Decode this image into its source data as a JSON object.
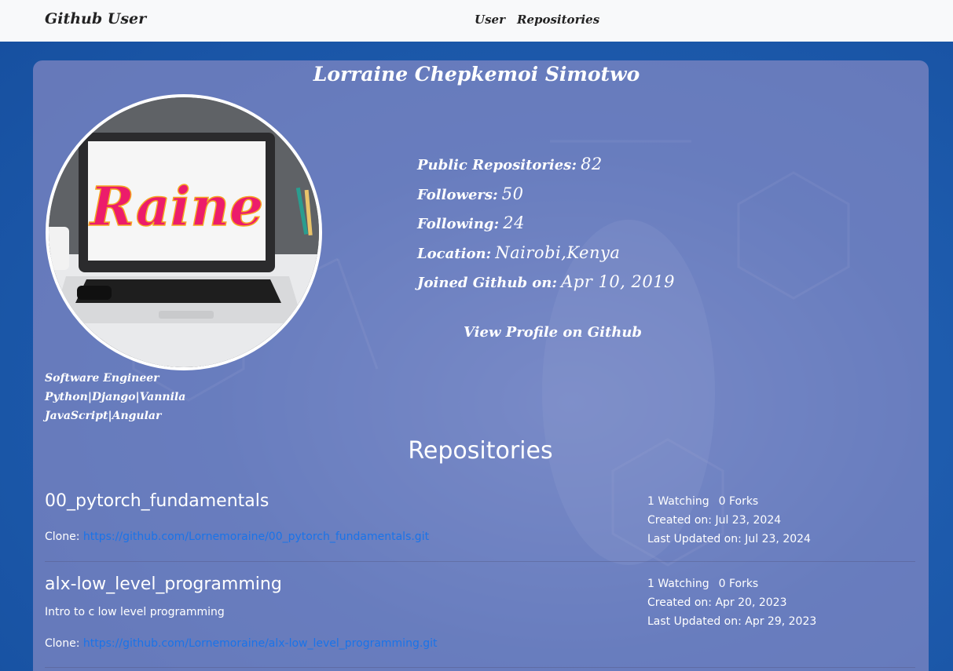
{
  "navbar": {
    "brand": "Github User",
    "links": [
      "User",
      "Repositories"
    ]
  },
  "profile": {
    "name": "Lorraine Chepkemoi Simotwo",
    "avatar_text": "Raine",
    "bio": "Software Engineer Python|Django|Vannila JavaScript|Angular",
    "stats": [
      {
        "label": "Public Repositories:",
        "value": "82"
      },
      {
        "label": "Followers:",
        "value": "50"
      },
      {
        "label": "Following:",
        "value": "24"
      },
      {
        "label": "Location:",
        "value": "Nairobi,Kenya"
      },
      {
        "label": "Joined Github on:",
        "value": "Apr 10, 2019"
      }
    ],
    "profile_link": "View Profile on Github"
  },
  "repositories": {
    "title": "Repositories",
    "items": [
      {
        "name": "00_pytorch_fundamentals",
        "description": "",
        "clone_label": "Clone:",
        "clone_url": "https://github.com/Lornemoraine/00_pytorch_fundamentals.git",
        "watching": "1 Watching",
        "forks": "0 Forks",
        "created": "Created on: Jul 23, 2024",
        "updated": "Last Updated on: Jul 23, 2024"
      },
      {
        "name": "alx-low_level_programming",
        "description": "Intro to c low level programming",
        "clone_label": "Clone:",
        "clone_url": "https://github.com/Lornemoraine/alx-low_level_programming.git",
        "watching": "1 Watching",
        "forks": "0 Forks",
        "created": "Created on: Apr 20, 2023",
        "updated": "Last Updated on: Apr 29, 2023"
      }
    ]
  },
  "colors": {
    "navbar_bg": "#f8f9fa",
    "page_bg": "#1e5cae",
    "card_bg": "#9691c8",
    "link": "#1a73e8",
    "avatar_border": "#ffffff"
  }
}
